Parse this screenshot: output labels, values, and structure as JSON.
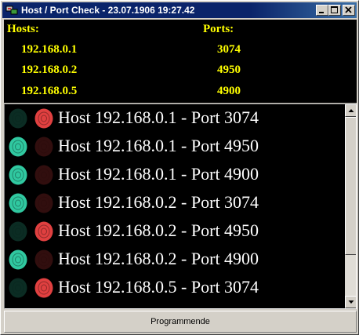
{
  "window": {
    "title": "Host / Port Check - 23.07.1906 19:27.42",
    "icon": "network-icon",
    "controls": [
      "minimize-icon",
      "maximize-icon",
      "close-icon"
    ]
  },
  "info": {
    "hosts_label": "Hosts:",
    "ports_label": "Ports:",
    "hosts": [
      "192.168.0.1",
      "192.168.0.2",
      "192.168.0.5"
    ],
    "ports": [
      "3074",
      "4950",
      "4900"
    ],
    "label_color": "#ffff00"
  },
  "results": [
    {
      "text": "Host 192.168.0.1 - Port 3074",
      "status": "closed"
    },
    {
      "text": "Host 192.168.0.1 - Port 4950",
      "status": "open"
    },
    {
      "text": "Host 192.168.0.1 - Port 4900",
      "status": "open"
    },
    {
      "text": "Host 192.168.0.2 - Port 3074",
      "status": "open"
    },
    {
      "text": "Host 192.168.0.2 - Port 4950",
      "status": "closed"
    },
    {
      "text": "Host 192.168.0.2 - Port 4900",
      "status": "open"
    },
    {
      "text": "Host 192.168.0.5 - Port 3074",
      "status": "closed"
    }
  ],
  "status_colors": {
    "open": "#30c8a0",
    "closed": "#e04040"
  },
  "status_bar": "Programmende"
}
